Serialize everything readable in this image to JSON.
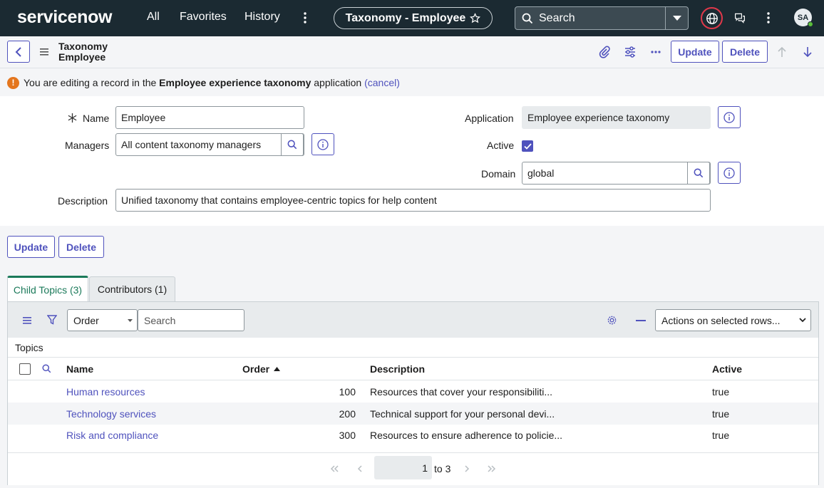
{
  "nav": {
    "logo": "servicenow",
    "links": [
      "All",
      "Favorites",
      "History"
    ],
    "context_pill": "Taxonomy - Employee",
    "search_label": "Search",
    "avatar_initials": "SA"
  },
  "header": {
    "title_line1": "Taxonomy",
    "title_line2": "Employee",
    "update_label": "Update",
    "delete_label": "Delete"
  },
  "notice": {
    "prefix": "You are editing a record in the ",
    "app_name": "Employee experience taxonomy",
    "suffix": " application ",
    "cancel": "(cancel)"
  },
  "form": {
    "name_label": "Name",
    "name_value": "Employee",
    "managers_label": "Managers",
    "managers_value": "All content taxonomy managers",
    "application_label": "Application",
    "application_value": "Employee experience taxonomy",
    "active_label": "Active",
    "active_checked": true,
    "domain_label": "Domain",
    "domain_value": "global",
    "description_label": "Description",
    "description_value": "Unified taxonomy that contains employee-centric topics for help content"
  },
  "actions": {
    "update_label": "Update",
    "delete_label": "Delete"
  },
  "tabs": [
    {
      "label": "Child Topics (3)",
      "active": true
    },
    {
      "label": "Contributors (1)",
      "active": false
    }
  ],
  "list": {
    "filter_field": "Order",
    "search_placeholder": "Search",
    "actions_select": "Actions on selected rows...",
    "breadcrumb": "Topics",
    "columns": {
      "name": "Name",
      "order": "Order",
      "description": "Description",
      "active": "Active"
    },
    "rows": [
      {
        "name": "Human resources",
        "order": "100",
        "description": "Resources that cover your responsibiliti...",
        "active": "true"
      },
      {
        "name": "Technology services",
        "order": "200",
        "description": "Technical support for your personal devi...",
        "active": "true"
      },
      {
        "name": "Risk and compliance",
        "order": "300",
        "description": "Resources to ensure adherence to policie...",
        "active": "true"
      }
    ],
    "pager": {
      "current": "1",
      "range_text": "to 3"
    }
  },
  "colors": {
    "nav_bg": "#1b2a32",
    "accent": "#4f52bd",
    "active_tab": "#1b7a5a",
    "warning": "#e4761e"
  }
}
